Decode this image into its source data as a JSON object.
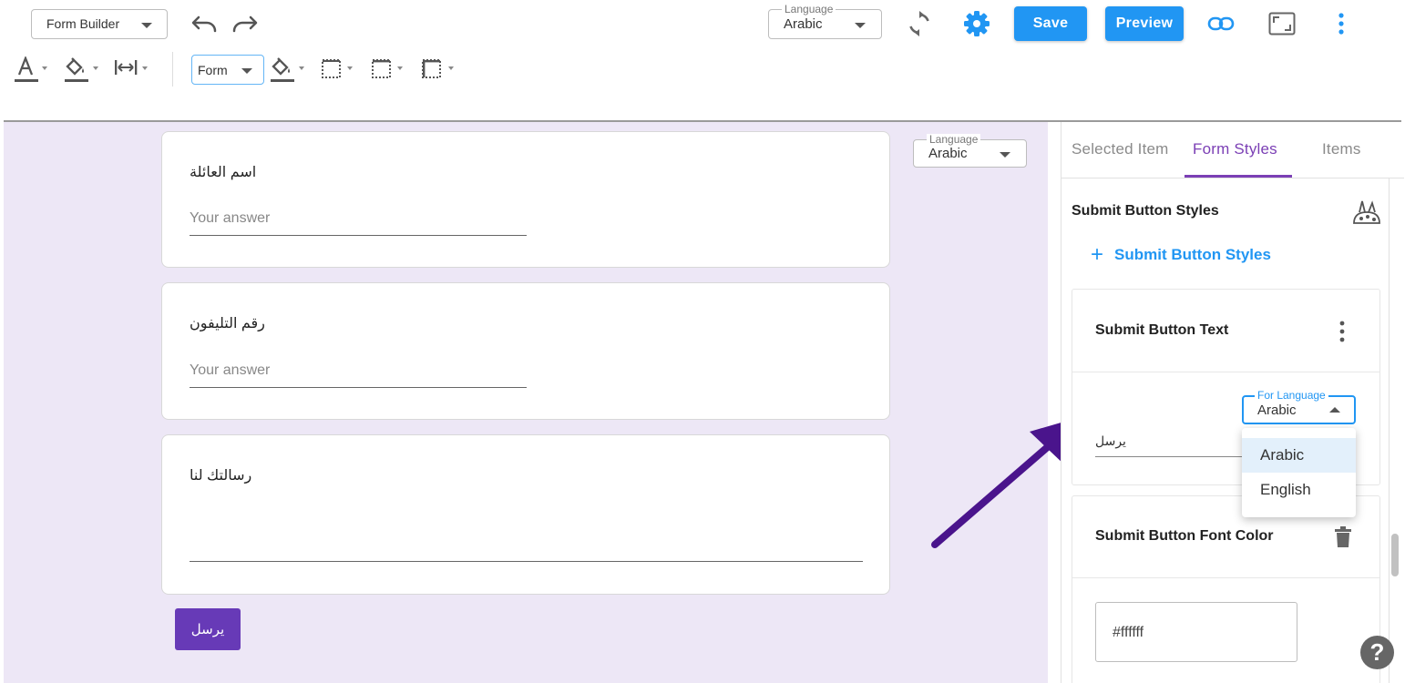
{
  "toolbar": {
    "mode_select": "Form Builder",
    "language_legend": "Language",
    "language_value": "Arabic",
    "save_label": "Save",
    "preview_label": "Preview",
    "form_select": "Form"
  },
  "canvas": {
    "language_legend": "Language",
    "language_value": "Arabic",
    "questions": [
      {
        "label": "اسم العائلة",
        "placeholder": "Your answer"
      },
      {
        "label": "رقم التليفون",
        "placeholder": "Your answer"
      },
      {
        "label": "رسالتك لنا",
        "placeholder": ""
      }
    ],
    "submit_label": "يرسل"
  },
  "panel": {
    "tabs": [
      {
        "label": "Selected Item",
        "active": false
      },
      {
        "label": "Form Styles",
        "active": true
      },
      {
        "label": "Items",
        "active": false
      }
    ],
    "section_title": "Submit Button Styles",
    "add_label": "Submit Button Styles",
    "text_card": {
      "title": "Submit Button Text",
      "for_language_legend": "For Language",
      "for_language_value": "Arabic",
      "text_value": "يرسل"
    },
    "color_card": {
      "title": "Submit Button Font Color",
      "color_value": "#ffffff"
    }
  },
  "dropdown": {
    "options": [
      "Arabic",
      "English"
    ],
    "selected": "Arabic"
  },
  "help_label": "?",
  "colors": {
    "primary": "#2196f3",
    "accent_purple": "#7b3fb5",
    "submit_purple": "#673ab7",
    "canvas_bg": "#ede7f6",
    "arrow": "#4a148c"
  }
}
